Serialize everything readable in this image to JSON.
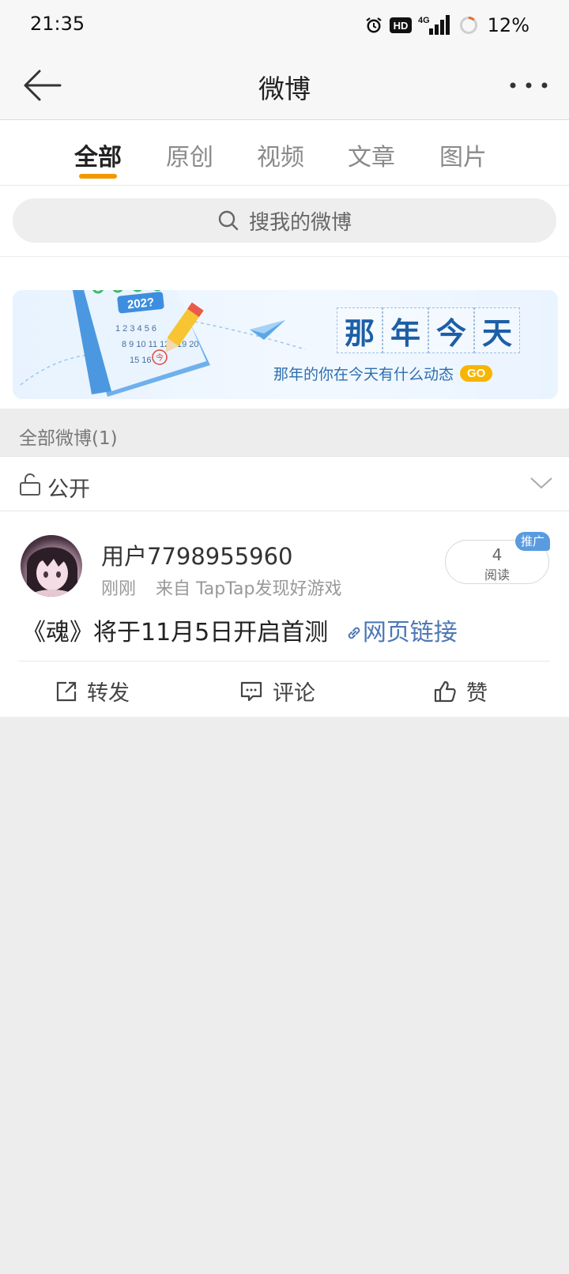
{
  "status_bar": {
    "time": "21:35",
    "hd_badge": "HD",
    "network": "4G",
    "battery": "12%",
    "icons": [
      "alarm-icon",
      "hd-icon",
      "signal-icon",
      "battery-ring-icon"
    ]
  },
  "nav": {
    "title": "微博",
    "back_icon": "back-arrow-icon",
    "more_icon": "more-dots-icon"
  },
  "tabs": [
    {
      "label": "全部",
      "active": true
    },
    {
      "label": "原创",
      "active": false
    },
    {
      "label": "视频",
      "active": false
    },
    {
      "label": "文章",
      "active": false
    },
    {
      "label": "图片",
      "active": false
    }
  ],
  "accent_color": "#f39800",
  "search": {
    "placeholder": "搜我的微博",
    "icon": "search-icon"
  },
  "banner": {
    "title_chars": [
      "那",
      "年",
      "今",
      "天"
    ],
    "subtitle": "那年的你在今天有什么动态",
    "go_label": "GO",
    "calendar_year": "202?",
    "calendar_days": "1 2 3 4 5 6",
    "calendar_days_2": "8 9 10 11 12",
    "calendar_days_3": "15 16",
    "calendar_days_4": "19 20",
    "calendar_today": "今"
  },
  "section": {
    "header": "全部微博(1)"
  },
  "filter": {
    "label": "公开",
    "icon": "unlock-icon"
  },
  "post": {
    "username": "用户7798955960",
    "time": "刚刚",
    "source": "来自 TapTap发现好游戏",
    "read_count": "4",
    "read_label": "阅读",
    "promo_badge": "推广",
    "text": "《魂》将于11月5日开启首测",
    "link_label": "网页链接",
    "actions": {
      "repost": "转发",
      "comment": "评论",
      "like": "赞"
    }
  }
}
